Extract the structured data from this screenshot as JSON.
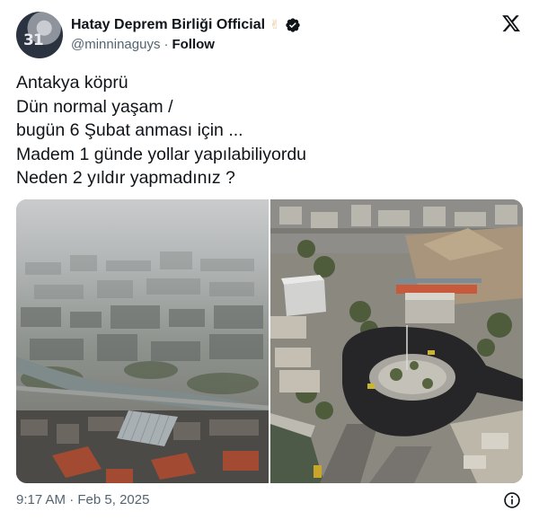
{
  "author": {
    "display_name": "Hatay Deprem Birliği Official",
    "emoji": "✌",
    "handle": "@minninaguys",
    "separator": "·",
    "follow_label": "Follow",
    "avatar_jersey_number": "31"
  },
  "tweet": {
    "lines": [
      "Antakya köprü",
      "Dün normal yaşam /",
      "bugün 6 Şubat anması için ...",
      "Madem 1 günde yollar yapılabiliyordu",
      "Neden 2 yıldır yapmadınız ?"
    ]
  },
  "footer": {
    "time": "9:17 AM",
    "separator": "·",
    "date": "Feb 5, 2025"
  },
  "icons": {
    "platform": "x-logo-icon",
    "verified": "verified-badge-icon",
    "info": "info-icon"
  },
  "colors": {
    "text_primary": "#0f1419",
    "text_secondary": "#536471",
    "verified_badge": "#0f1419"
  }
}
